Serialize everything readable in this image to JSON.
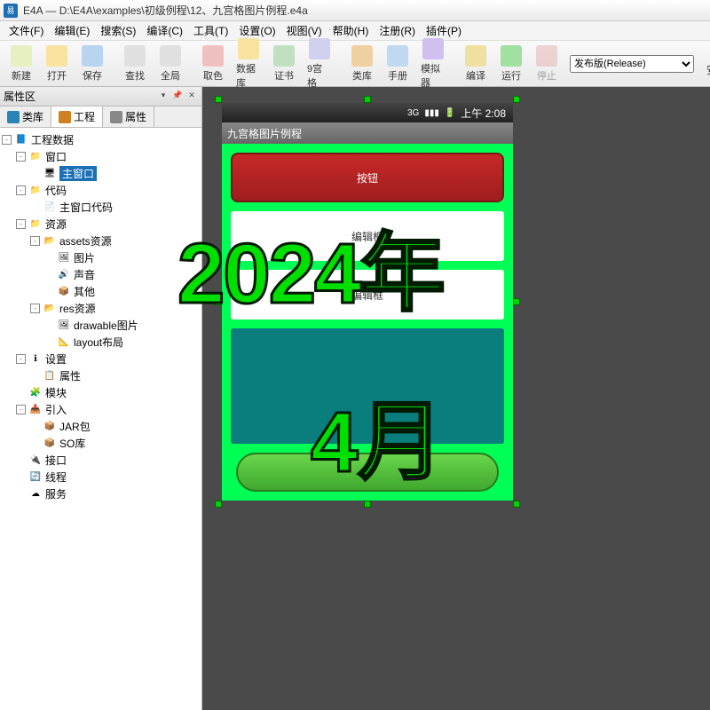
{
  "titlebar": {
    "app": "E4A",
    "path": "D:\\E4A\\examples\\初级例程\\12、九宫格图片例程.e4a"
  },
  "menu": [
    "文件(F)",
    "编辑(E)",
    "搜索(S)",
    "编译(C)",
    "工具(T)",
    "设置(O)",
    "视图(V)",
    "帮助(H)",
    "注册(R)",
    "插件(P)"
  ],
  "toolbar": {
    "items": [
      {
        "label": "新建",
        "bg": "#e6f0c0"
      },
      {
        "label": "打开",
        "bg": "#f7e2a0"
      },
      {
        "label": "保存",
        "bg": "#b8d4f0"
      },
      {
        "label": "sep"
      },
      {
        "label": "查找",
        "bg": "#e0e0e0"
      },
      {
        "label": "全局",
        "bg": "#e0e0e0"
      },
      {
        "label": "sep"
      },
      {
        "label": "取色",
        "bg": "#f0c0c0"
      },
      {
        "label": "数据库",
        "bg": "#f7e2a0"
      },
      {
        "label": "证书",
        "bg": "#c0e0c0"
      },
      {
        "label": "9宫格",
        "bg": "#d0d0f0"
      },
      {
        "label": "sep"
      },
      {
        "label": "类库",
        "bg": "#f0d0a0"
      },
      {
        "label": "手册",
        "bg": "#c0d8f0"
      },
      {
        "label": "模拟器",
        "bg": "#d0c0f0"
      },
      {
        "label": "sep"
      },
      {
        "label": "编译",
        "bg": "#f0e0a0"
      },
      {
        "label": "运行",
        "bg": "#a0e0a0"
      },
      {
        "label": "停止",
        "bg": "#e0a0a0",
        "dis": true
      }
    ],
    "combo": "发布版(Release)",
    "extra": "安"
  },
  "left": {
    "panel_title": "属性区",
    "tabs": [
      {
        "label": "类库",
        "icon": "#2a84b5"
      },
      {
        "label": "工程",
        "icon": "#d08020",
        "active": true
      },
      {
        "label": "属性",
        "icon": "#888"
      }
    ],
    "tree": [
      {
        "d": 0,
        "exp": "-",
        "icon": "📘",
        "label": "工程数据"
      },
      {
        "d": 1,
        "exp": "-",
        "icon": "📁",
        "label": "窗口"
      },
      {
        "d": 2,
        "exp": "",
        "icon": "🖥",
        "label": "主窗口",
        "sel": true
      },
      {
        "d": 1,
        "exp": "-",
        "icon": "📁",
        "label": "代码"
      },
      {
        "d": 2,
        "exp": "",
        "icon": "📄",
        "label": "主窗口代码"
      },
      {
        "d": 1,
        "exp": "-",
        "icon": "📁",
        "label": "资源"
      },
      {
        "d": 2,
        "exp": "-",
        "icon": "📂",
        "label": "assets资源"
      },
      {
        "d": 3,
        "exp": "",
        "icon": "🖼",
        "label": "图片"
      },
      {
        "d": 3,
        "exp": "",
        "icon": "🔊",
        "label": "声音"
      },
      {
        "d": 3,
        "exp": "",
        "icon": "📦",
        "label": "其他"
      },
      {
        "d": 2,
        "exp": "-",
        "icon": "📂",
        "label": "res资源"
      },
      {
        "d": 3,
        "exp": "",
        "icon": "🖼",
        "label": "drawable图片"
      },
      {
        "d": 3,
        "exp": "",
        "icon": "📐",
        "label": "layout布局"
      },
      {
        "d": 1,
        "exp": "-",
        "icon": "ℹ",
        "label": "设置"
      },
      {
        "d": 2,
        "exp": "",
        "icon": "📋",
        "label": "属性"
      },
      {
        "d": 1,
        "exp": "",
        "icon": "🧩",
        "label": "模块"
      },
      {
        "d": 1,
        "exp": "-",
        "icon": "📥",
        "label": "引入"
      },
      {
        "d": 2,
        "exp": "",
        "icon": "📦",
        "label": "JAR包"
      },
      {
        "d": 2,
        "exp": "",
        "icon": "📦",
        "label": "SO库"
      },
      {
        "d": 1,
        "exp": "",
        "icon": "🔌",
        "label": "接口"
      },
      {
        "d": 1,
        "exp": "",
        "icon": "🔄",
        "label": "线程"
      },
      {
        "d": 1,
        "exp": "",
        "icon": "☁",
        "label": "服务"
      }
    ]
  },
  "device": {
    "status_time": "上午 2:08",
    "app_title": "九宫格图片例程",
    "button_label": "按钮",
    "edit1": "编辑框",
    "edit2": "编辑框"
  },
  "overlay": {
    "line1": "2024年",
    "line2": "4月"
  }
}
